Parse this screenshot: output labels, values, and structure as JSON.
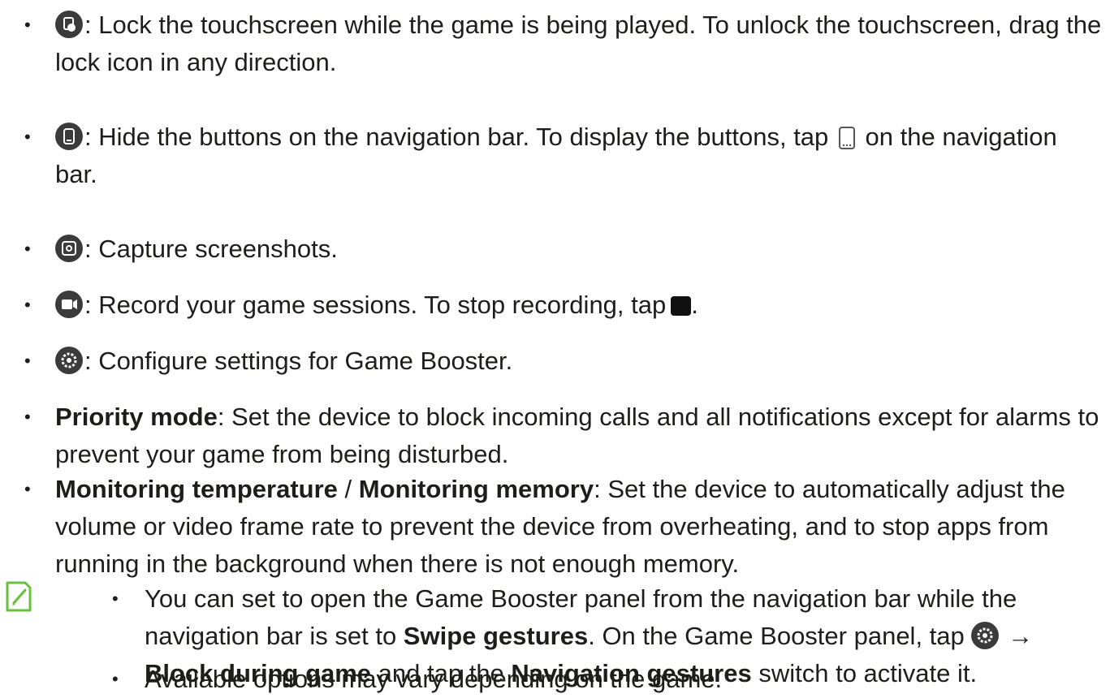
{
  "bullet_char": "•",
  "items": [
    {
      "icon": "lock-touch-icon",
      "text": ": Lock the touchscreen while the game is being played. To unlock the touchscreen, drag the lock icon in any direction."
    },
    {
      "icon": "hide-nav-icon",
      "text_a": ": Hide the buttons on the navigation bar. To display the buttons, tap",
      "text_b": "on the navigation bar."
    },
    {
      "icon": "screenshot-icon",
      "text": ": Capture screenshots."
    },
    {
      "icon": "record-icon",
      "text_a": ": Record your game sessions. To stop recording, tap",
      "text_b": "."
    },
    {
      "icon": "settings-icon",
      "text": ": Configure settings for Game Booster."
    },
    {
      "term": "Priority mode",
      "text": ": Set the device to block incoming calls and all notifications except for alarms to prevent your game from being disturbed."
    },
    {
      "term_a": "Monitoring temperature",
      "sep": " / ",
      "term_b": "Monitoring memory",
      "text": ": Set the device to automatically adjust the volume or video frame rate to prevent the device from overheating, and to stop apps from running in the background when there is not enough memory."
    }
  ],
  "note": {
    "icon": "note-icon",
    "accent_color": "#6abf3d",
    "sub_items": [
      {
        "t1": "You can set to open the Game Booster panel from the navigation bar while the navigation bar is set to ",
        "b1": "Swipe gestures",
        "t2": ". On the Game Booster panel, tap ",
        "arrow": " → ",
        "b2": "Block during game",
        "t3": " and tap the ",
        "b3": "Navigation gestures",
        "t4": " switch to activate it."
      },
      {
        "t1": "Available options may vary depending on the game."
      }
    ]
  }
}
